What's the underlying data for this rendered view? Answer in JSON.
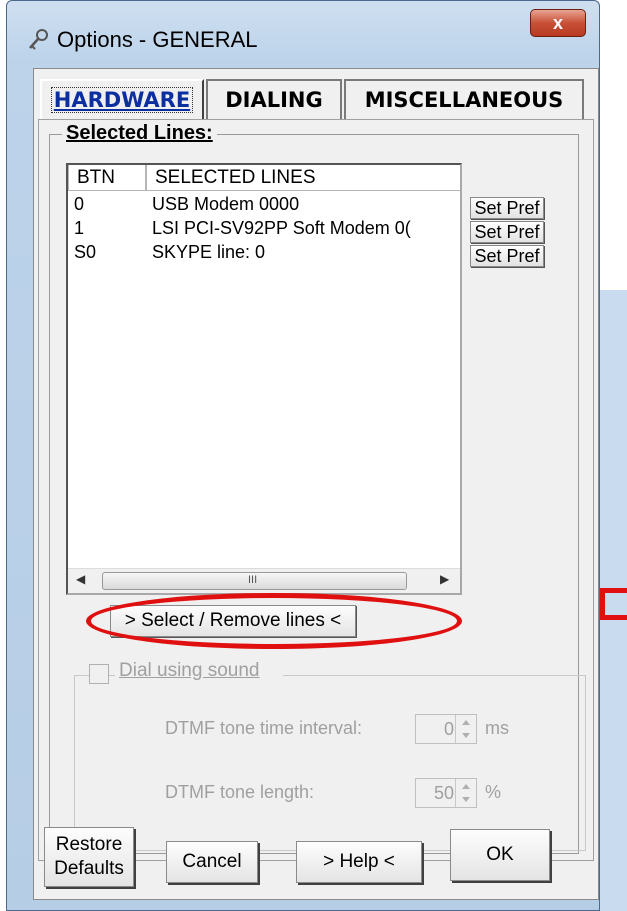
{
  "window": {
    "title": "Options - GENERAL",
    "close_glyph": "x",
    "icon": "key-wrench-icon"
  },
  "tabs": [
    {
      "label": "HARDWARE",
      "active": true
    },
    {
      "label": "DIALING",
      "active": false
    },
    {
      "label": "MISCELLANEOUS",
      "active": false
    }
  ],
  "selected_lines": {
    "group_label": "Selected Lines:",
    "columns": [
      "BTN",
      "SELECTED LINES"
    ],
    "rows": [
      {
        "btn": "0",
        "line": "USB Modem 0000"
      },
      {
        "btn": "1",
        "line": "LSI PCI-SV92PP Soft Modem 0("
      },
      {
        "btn": "S0",
        "line": "SKYPE line: 0"
      }
    ],
    "set_pref_label": "Set Pref",
    "scroll_grip": "III",
    "select_button_label": "> Select / Remove lines <"
  },
  "dial_sound": {
    "checkbox_label": "Dial using sound",
    "checked": false,
    "interval_label": "DTMF tone time interval:",
    "interval_value": "0",
    "interval_unit": "ms",
    "length_label": "DTMF tone length:",
    "length_value": "50",
    "length_unit": "%"
  },
  "buttons": {
    "restore_line1": "Restore",
    "restore_line2": "Defaults",
    "cancel": "Cancel",
    "help": "> Help <",
    "ok": "OK"
  },
  "colors": {
    "annotation_red": "#e01010",
    "close_button": "#c85037",
    "active_tab_text": "#0b2ea0"
  }
}
